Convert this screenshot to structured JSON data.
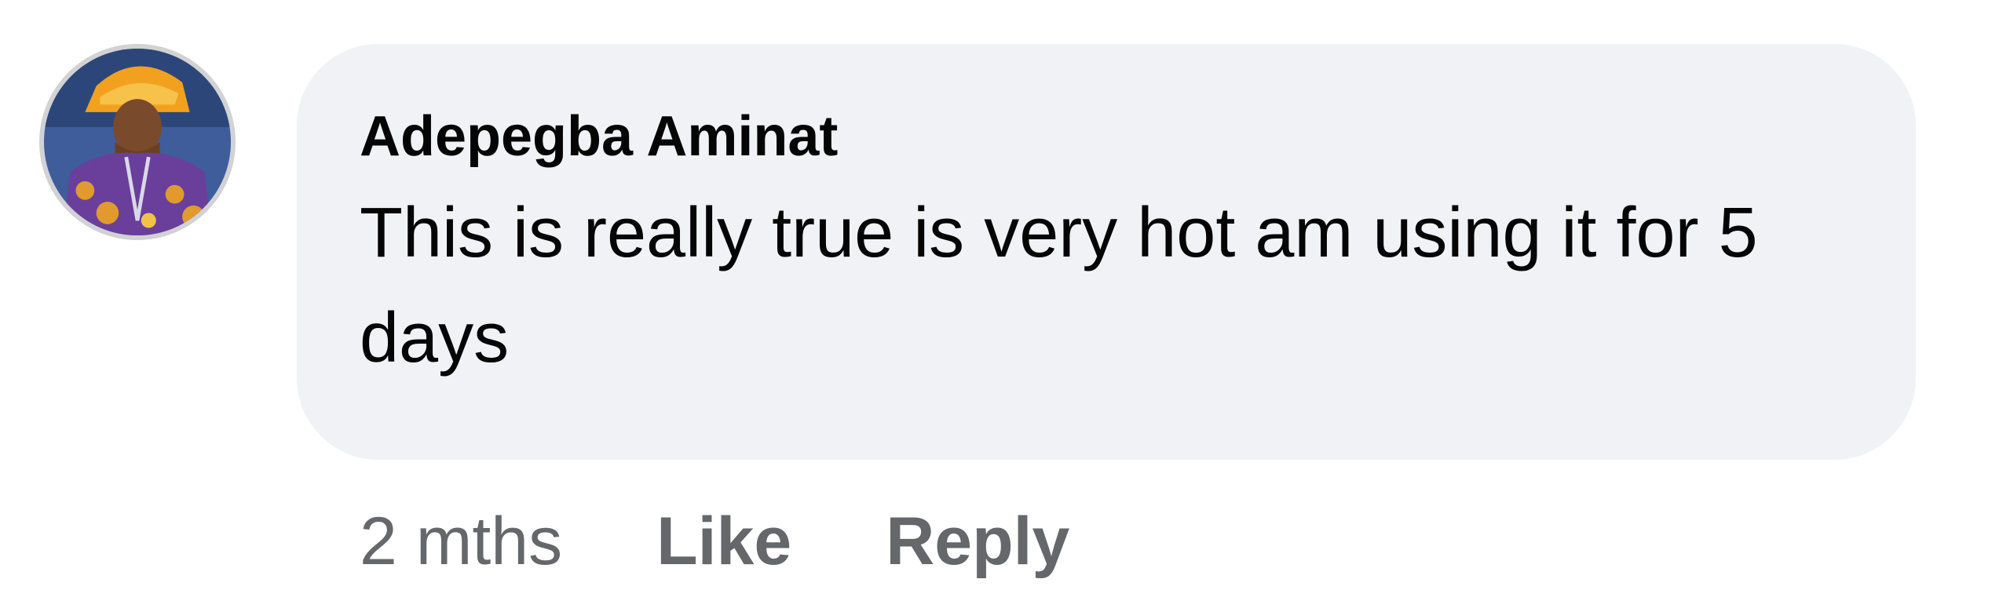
{
  "comment": {
    "author": "Adepegba Aminat",
    "text": "This is really true is very hot am using it for 5 days",
    "timestamp": "2 mths",
    "actions": {
      "like_label": "Like",
      "reply_label": "Reply"
    }
  },
  "colors": {
    "bubble_background": "#f0f2f5",
    "text_primary": "#050505",
    "text_secondary": "#65676b"
  }
}
